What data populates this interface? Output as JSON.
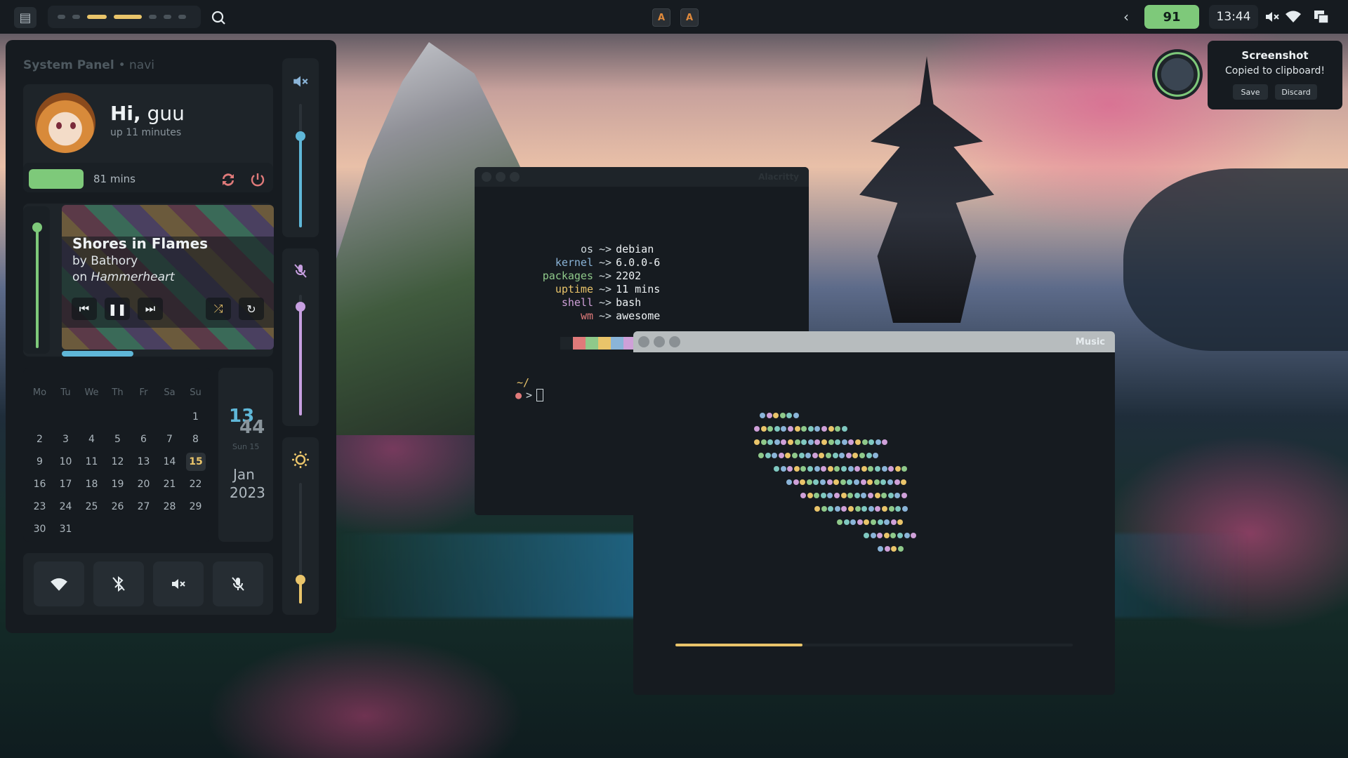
{
  "topbar": {
    "launcher_icon": "app-launcher-icon",
    "tags": [
      {
        "state": "occupied"
      },
      {
        "state": "occupied"
      },
      {
        "state": "active"
      },
      {
        "state": "active"
      },
      {
        "state": "empty"
      },
      {
        "state": "empty"
      },
      {
        "state": "empty"
      }
    ],
    "search_icon": "search-icon",
    "tasks": [
      {
        "icon": "alacritty-icon",
        "glyph": "A"
      },
      {
        "icon": "alacritty-icon",
        "glyph": "A"
      }
    ],
    "battery": "91",
    "clock": "13:44",
    "status_icons": [
      "chevron-left-icon",
      "volume-mute-icon",
      "wifi-icon",
      "layout-icon"
    ]
  },
  "panel": {
    "title": "System Panel",
    "subtitle": "• navi",
    "greeting_prefix": "Hi,",
    "user": "guu",
    "uptime": "up 11 minutes",
    "session_minutes": "81 mins",
    "media": {
      "title": "Shores in Flames",
      "artist": "by Bathory",
      "album_prefix": "on",
      "album": "Hammerheart",
      "progress": 0.34,
      "volume_level": 0.85
    },
    "calendar": {
      "weekdays": [
        "Mo",
        "Tu",
        "We",
        "Th",
        "Fr",
        "Sa",
        "Su"
      ],
      "weeks": [
        [
          "",
          "",
          "",
          "",
          "",
          "",
          "1"
        ],
        [
          "2",
          "3",
          "4",
          "5",
          "6",
          "7",
          "8"
        ],
        [
          "9",
          "10",
          "11",
          "12",
          "13",
          "14",
          "15"
        ],
        [
          "16",
          "17",
          "18",
          "19",
          "20",
          "21",
          "22"
        ],
        [
          "23",
          "24",
          "25",
          "26",
          "27",
          "28",
          "29"
        ],
        [
          "30",
          "31",
          "",
          "",
          "",
          "",
          ""
        ]
      ],
      "today": "15"
    },
    "date_card": {
      "hour": "13",
      "minute": "44",
      "day": "Sun 15",
      "month": "Jan",
      "year": "2023"
    },
    "quick_toggles": [
      "wifi-icon",
      "bluetooth-off-icon",
      "volume-mute-icon",
      "mic-off-icon"
    ],
    "sliders": {
      "volume": 0.74,
      "mic": 0.9,
      "brightness": 0.2
    }
  },
  "notification": {
    "title": "Screenshot",
    "body": "Copied to clipboard!",
    "save_label": "Save",
    "discard_label": "Discard"
  },
  "terminal": {
    "title": "Alacritty",
    "fetch": [
      {
        "key": "os",
        "sep": "~>",
        "value": "debian",
        "color": "#cfd8dc"
      },
      {
        "key": "kernel",
        "sep": "~>",
        "value": "6.0.0-6",
        "color": "#8ab4d8"
      },
      {
        "key": "packages",
        "sep": "~>",
        "value": "2202",
        "color": "#8fc98a"
      },
      {
        "key": "uptime",
        "sep": "~>",
        "value": "11 mins",
        "color": "#e9c46a"
      },
      {
        "key": "shell",
        "sep": "~>",
        "value": "bash",
        "color": "#cfa0d8"
      },
      {
        "key": "wm",
        "sep": "~>",
        "value": "awesome",
        "color": "#e07a7a"
      }
    ],
    "palette": [
      "#1e2429",
      "#e07a7a",
      "#8fc98a",
      "#e9c46a",
      "#8ab4d8",
      "#cfa0d8",
      "#7fc8c0",
      "#cfd8dc"
    ],
    "cwd": "~/",
    "prompt_symbol": ">"
  },
  "music_window": {
    "title": "Music",
    "progress": 0.32
  },
  "colors": {
    "accent_green": "#7ec97a",
    "accent_yellow": "#e9c46a",
    "accent_blue": "#5fb7d8",
    "accent_purple": "#c79fe0",
    "bg_panel": "#161b20"
  }
}
